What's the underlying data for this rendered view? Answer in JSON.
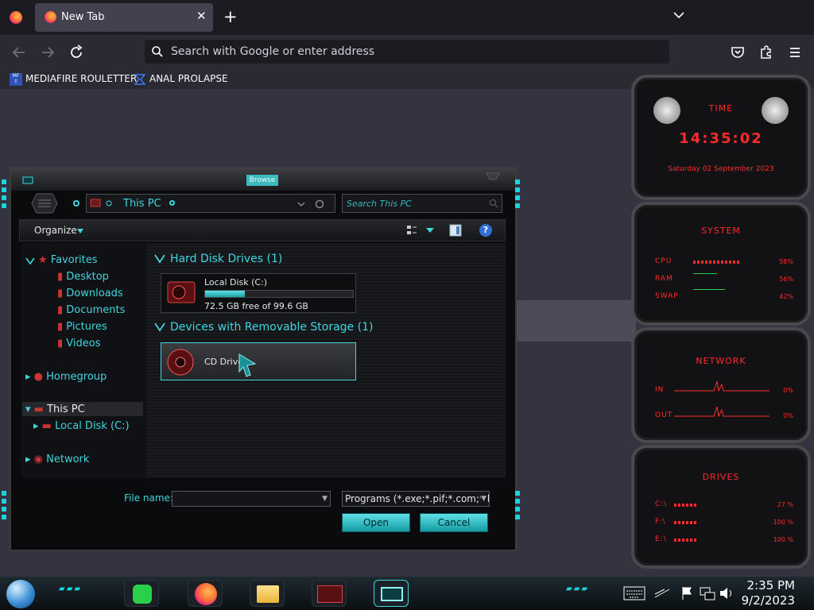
{
  "browser": {
    "tab_title": "New Tab",
    "tab_close": "✕",
    "new_tab": "+",
    "url_placeholder": "Search with Google or enter address",
    "bookmarks": [
      {
        "label": "MEDIAFIRE ROULETTER",
        "icon": "mediafire-icon"
      },
      {
        "label": "ANAL PROLAPSE",
        "icon": "bookmark-page-icon"
      }
    ]
  },
  "dialog": {
    "title": "Browse",
    "address": "This PC",
    "search_placeholder": "Search This PC",
    "organize_label": "Organize",
    "nav": {
      "favorites": "Favorites",
      "desktop": "Desktop",
      "downloads": "Downloads",
      "documents": "Documents",
      "pictures": "Pictures",
      "videos": "Videos",
      "homegroup": "Homegroup",
      "this_pc": "This PC",
      "local_disk": "Local Disk (C:)",
      "network": "Network"
    },
    "groups": {
      "hdd": "Hard Disk Drives (1)",
      "removable": "Devices with Removable Storage (1)"
    },
    "drive_c": {
      "name": "Local Disk (C:)",
      "free": "72.5 GB free of 99.6 GB",
      "used_fraction": 0.27
    },
    "cd_drive": "CD Drive",
    "filename_label": "File name:",
    "filename_value": "",
    "filetype_value": "Programs (*.exe;*.pif;*.com;*.ba",
    "open_label": "Open",
    "cancel_label": "Cancel"
  },
  "gadget": {
    "time_title": "TIME",
    "time_value": "14:35:02",
    "date_value": "Saturday 02 September 2023",
    "system_title": "SYSTEM",
    "cpu_label": "CPU",
    "cpu_value": "58%",
    "ram_label": "RAM",
    "ram_value": "56%",
    "swap_label": "SWAP",
    "swap_value": "42%",
    "network_title": "NETWORK",
    "in_label": "IN",
    "in_value": "0%",
    "out_label": "OUT",
    "out_value": "0%",
    "drives_title": "DRIVES",
    "drives": [
      {
        "label": "C:\\",
        "value": "27 %"
      },
      {
        "label": "F:\\",
        "value": "100 %"
      },
      {
        "label": "E:\\",
        "value": "100 %"
      }
    ]
  },
  "taskbar": {
    "time": "2:35 PM",
    "date": "9/2/2023"
  },
  "colors": {
    "accent_cyan": "#3fd6de",
    "gadget_red": "#ff2b2b",
    "browser_bg": "#2b2a33"
  }
}
